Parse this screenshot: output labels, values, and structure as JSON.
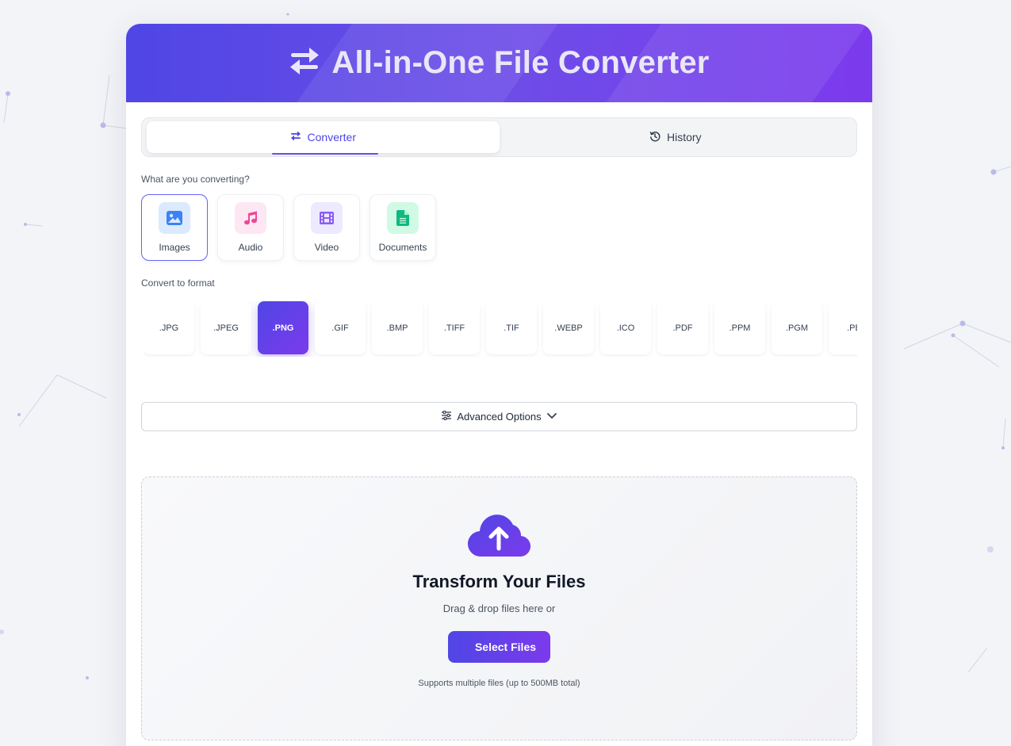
{
  "header": {
    "title": "All-in-One File Converter",
    "icon": "swap-arrows-icon"
  },
  "tabs": [
    {
      "label": "Converter",
      "icon": "swap-arrows-icon",
      "active": true
    },
    {
      "label": "History",
      "icon": "history-icon",
      "active": false
    }
  ],
  "categories": {
    "prompt": "What are you converting?",
    "items": [
      {
        "label": "Images",
        "icon": "image-icon",
        "active": true,
        "color": "#3b82f6",
        "bg": "#dbeafe"
      },
      {
        "label": "Audio",
        "icon": "music-note-icon",
        "active": false,
        "color": "#ec4899",
        "bg": "#fce7f3"
      },
      {
        "label": "Video",
        "icon": "film-icon",
        "active": false,
        "color": "#8b5cf6",
        "bg": "#ede9fe"
      },
      {
        "label": "Documents",
        "icon": "document-icon",
        "active": false,
        "color": "#10b981",
        "bg": "#d1fae5"
      }
    ]
  },
  "formats": {
    "label": "Convert to format",
    "items": [
      ".JPG",
      ".JPEG",
      ".PNG",
      ".GIF",
      ".BMP",
      ".TIFF",
      ".TIF",
      ".WEBP",
      ".ICO",
      ".PDF",
      ".PPM",
      ".PGM",
      ".PB"
    ],
    "selected": ".PNG"
  },
  "advanced": {
    "label": "Advanced Options"
  },
  "dropzone": {
    "icon": "cloud-upload-icon",
    "title": "Transform Your Files",
    "subtitle": "Drag & drop files here or",
    "button": "Select Files",
    "note": "Supports multiple files (up to 500MB total)"
  },
  "colors": {
    "accent": "#4f46e5",
    "accent2": "#7c3aed",
    "background": "#f3f4f7"
  }
}
